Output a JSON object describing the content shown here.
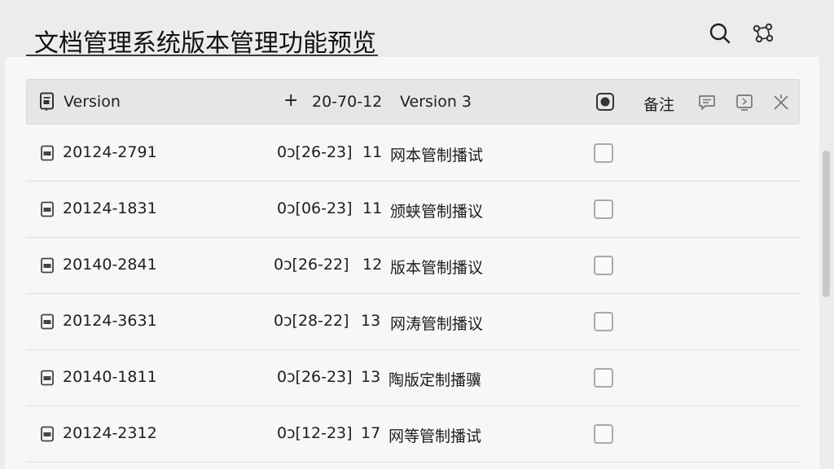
{
  "header": {
    "title": "文档管理系统版本管理功能预览"
  },
  "toolbar": {
    "search_icon": "search-icon",
    "share_icon": "share-nodes-icon"
  },
  "table": {
    "header": {
      "version_label": "Version",
      "add_symbol": "+",
      "date": "20-70-12",
      "current_version": "Version 3",
      "notes_label": "备注"
    },
    "rows": [
      {
        "id": "20124-2791",
        "date": "0ↄ[26-23]",
        "count": "11",
        "desc": "网本管制播试"
      },
      {
        "id": "20124-1831",
        "date": "0ↄ[06-23]",
        "count": "11",
        "desc": "颁蛱管制播议"
      },
      {
        "id": "20140-2841",
        "date": "0ↄ[26-22]",
        "count": "12",
        "desc": "版本管制播议"
      },
      {
        "id": "20124-3631",
        "date": "0ↄ[28-22]",
        "count": "13",
        "desc": "网涛管制播议"
      },
      {
        "id": "20140-1811",
        "date": "0ↄ[26-23]",
        "count": "13",
        "desc": "陶版定制播骥"
      },
      {
        "id": "20124-2312",
        "date": "0ↄ[12-23]",
        "count": "17",
        "desc": "网等管制播试"
      }
    ]
  },
  "colors": {
    "background": "#ececec",
    "panel": "#f7f7f7",
    "header_row": "#e6e6e6",
    "text": "#1e1e1e"
  }
}
